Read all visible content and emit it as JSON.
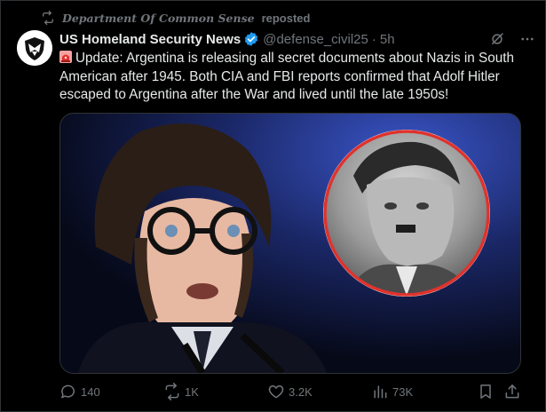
{
  "repost": {
    "icon": "repost-icon",
    "reposter": "Department Of Common Sense",
    "suffix": "reposted"
  },
  "author": {
    "avatar_icon": "shield-eagle-logo",
    "display_name": "US Homeland Security News",
    "verified": true,
    "verified_color": "#1d9bf0",
    "handle": "@defense_civil25",
    "separator": "·",
    "time": "5h"
  },
  "tweet": {
    "emoji": "siren-icon",
    "text": "Update: Argentina is releasing all secret documents about Nazis in South American after 1945. Both CIA and FBI reports confirmed that Adolf Hitler escaped to Argentina after the War and lived until the late 1950s!"
  },
  "media": {
    "type": "photo",
    "inset_border_color": "#e0322c"
  },
  "actions": {
    "reply_count": "140",
    "repost_count": "1K",
    "like_count": "3.2K",
    "view_count": "73K"
  },
  "colors": {
    "background": "#000000",
    "text": "#e7e9ea",
    "muted": "#71767b",
    "accent": "#1d9bf0"
  }
}
